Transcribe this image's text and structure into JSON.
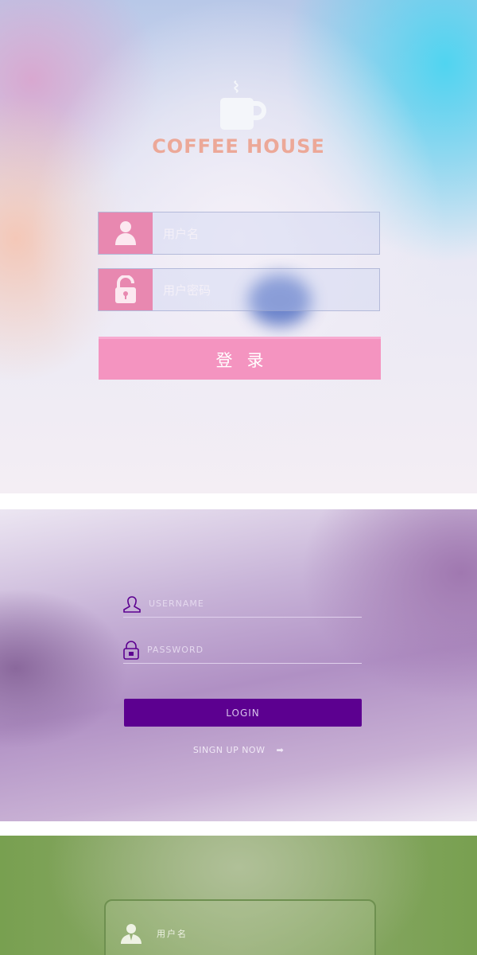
{
  "screen1": {
    "logo": "COFFEE HOUSE",
    "username_placeholder": "用户名",
    "password_placeholder": "用户密码",
    "login_label": "登录",
    "accent": "#e888b0"
  },
  "screen2": {
    "username_placeholder": "USERNAME",
    "password_placeholder": "PASSWORD",
    "login_label": "LOGIN",
    "signup_label": "SINGN UP NOW",
    "signup_icon": "arrow-right-icon",
    "accent": "#5c0090"
  },
  "screen3": {
    "username_placeholder": "用户名"
  }
}
